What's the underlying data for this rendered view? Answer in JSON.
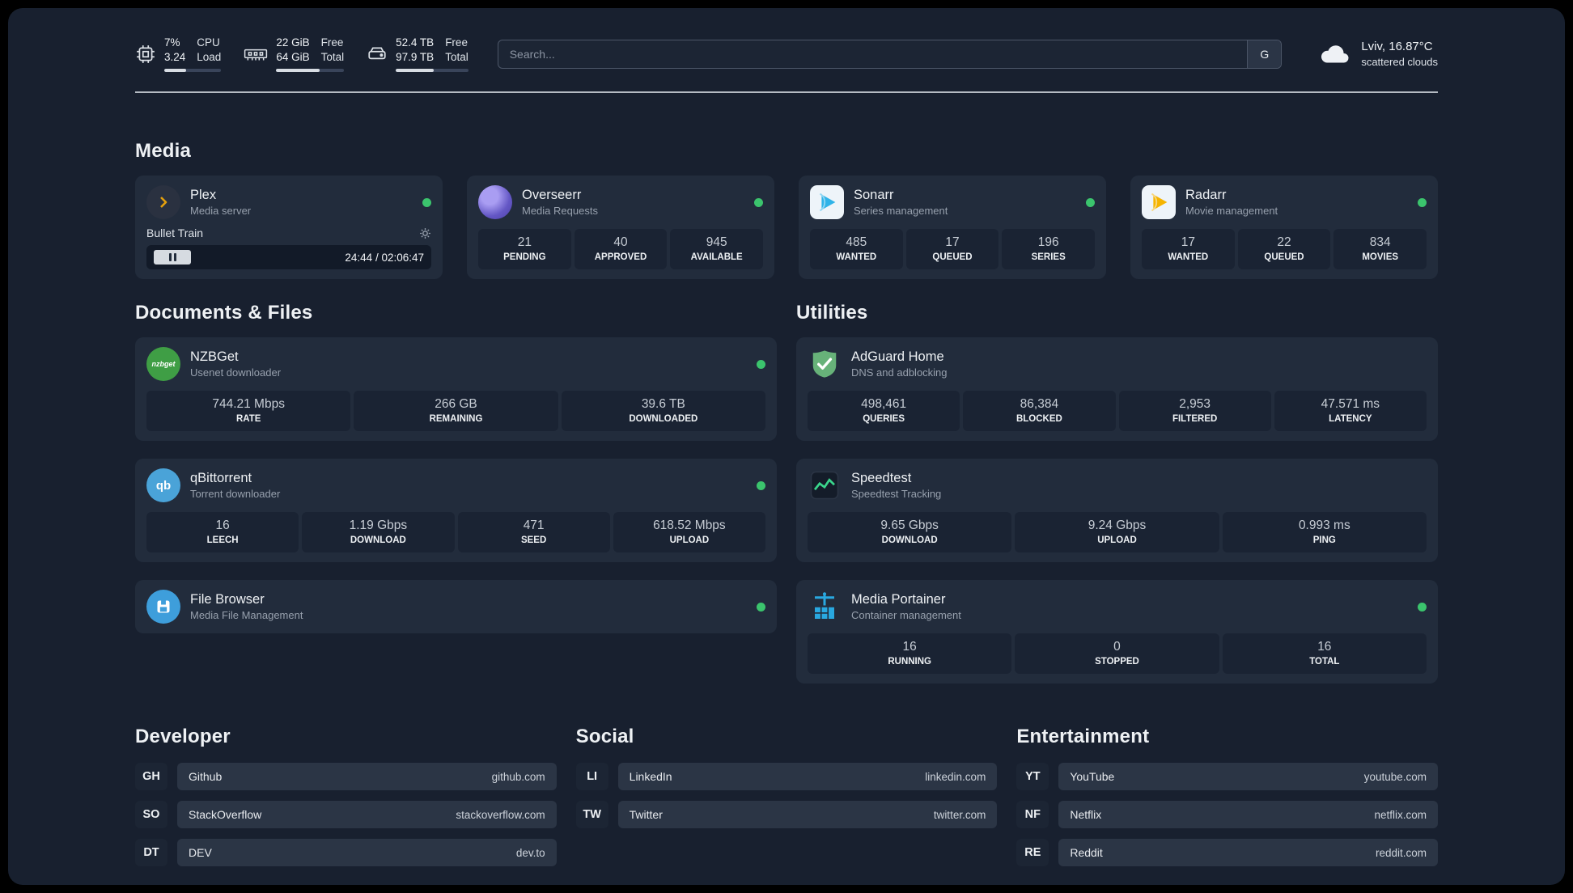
{
  "theme": {
    "background": "#18202f",
    "card": "#222c3c",
    "stat_box": "#1a2333",
    "status_green": "#3bc46d",
    "plex_accent": "#e5a00d"
  },
  "topbar": {
    "cpu": {
      "icon": "cpu-chip-icon",
      "value_top": "7%",
      "value_bottom": "3.24",
      "label_top": "CPU",
      "label_bottom": "Load"
    },
    "memory": {
      "icon": "memory-icon",
      "value_top": "22 GiB",
      "value_bottom": "64 GiB",
      "label_top": "Free",
      "label_bottom": "Total"
    },
    "storage": {
      "icon": "storage-icon",
      "value_top": "52.4 TB",
      "value_bottom": "97.9 TB",
      "label_top": "Free",
      "label_bottom": "Total"
    },
    "search": {
      "placeholder": "Search...",
      "engine_button": "G"
    },
    "weather": {
      "icon": "cloud-icon",
      "location_temp": "Lviv, 16.87°C",
      "condition": "scattered clouds"
    }
  },
  "media": {
    "title": "Media",
    "cards": [
      {
        "icon": "plex-icon",
        "name": "Plex",
        "subtitle": "Media server",
        "now_playing": {
          "title": "Bullet Train",
          "time": "24:44 / 02:06:47"
        }
      },
      {
        "icon": "overseerr-icon",
        "name": "Overseerr",
        "subtitle": "Media Requests",
        "stats": [
          {
            "value": "21",
            "label": "PENDING"
          },
          {
            "value": "40",
            "label": "APPROVED"
          },
          {
            "value": "945",
            "label": "AVAILABLE"
          }
        ]
      },
      {
        "icon": "sonarr-icon",
        "name": "Sonarr",
        "subtitle": "Series management",
        "stats": [
          {
            "value": "485",
            "label": "WANTED"
          },
          {
            "value": "17",
            "label": "QUEUED"
          },
          {
            "value": "196",
            "label": "SERIES"
          }
        ]
      },
      {
        "icon": "radarr-icon",
        "name": "Radarr",
        "subtitle": "Movie management",
        "stats": [
          {
            "value": "17",
            "label": "WANTED"
          },
          {
            "value": "22",
            "label": "QUEUED"
          },
          {
            "value": "834",
            "label": "MOVIES"
          }
        ]
      }
    ]
  },
  "documents": {
    "title": "Documents & Files",
    "cards": [
      {
        "icon": "nzbget-icon",
        "icon_text": "nzbget",
        "name": "NZBGet",
        "subtitle": "Usenet downloader",
        "stats": [
          {
            "value": "744.21 Mbps",
            "label": "RATE"
          },
          {
            "value": "266 GB",
            "label": "REMAINING"
          },
          {
            "value": "39.6 TB",
            "label": "DOWNLOADED"
          }
        ]
      },
      {
        "icon": "qbittorrent-icon",
        "icon_text": "qb",
        "name": "qBittorrent",
        "subtitle": "Torrent downloader",
        "stats": [
          {
            "value": "16",
            "label": "LEECH"
          },
          {
            "value": "1.19 Gbps",
            "label": "DOWNLOAD"
          },
          {
            "value": "471",
            "label": "SEED"
          },
          {
            "value": "618.52 Mbps",
            "label": "UPLOAD"
          }
        ]
      },
      {
        "icon": "filebrowser-icon",
        "name": "File Browser",
        "subtitle": "Media File Management"
      }
    ]
  },
  "utilities": {
    "title": "Utilities",
    "cards": [
      {
        "icon": "adguard-icon",
        "name": "AdGuard Home",
        "subtitle": "DNS and adblocking",
        "stats": [
          {
            "value": "498,461",
            "label": "QUERIES"
          },
          {
            "value": "86,384",
            "label": "BLOCKED"
          },
          {
            "value": "2,953",
            "label": "FILTERED"
          },
          {
            "value": "47.571 ms",
            "label": "LATENCY"
          }
        ]
      },
      {
        "icon": "speedtest-icon",
        "name": "Speedtest",
        "subtitle": "Speedtest Tracking",
        "stats": [
          {
            "value": "9.65 Gbps",
            "label": "DOWNLOAD"
          },
          {
            "value": "9.24 Gbps",
            "label": "UPLOAD"
          },
          {
            "value": "0.993 ms",
            "label": "PING"
          }
        ]
      },
      {
        "icon": "portainer-icon",
        "name": "Media Portainer",
        "subtitle": "Container management",
        "stats": [
          {
            "value": "16",
            "label": "RUNNING"
          },
          {
            "value": "0",
            "label": "STOPPED"
          },
          {
            "value": "16",
            "label": "TOTAL"
          }
        ]
      }
    ]
  },
  "bookmarks": [
    {
      "title": "Developer",
      "items": [
        {
          "abbr": "GH",
          "name": "Github",
          "url": "github.com"
        },
        {
          "abbr": "SO",
          "name": "StackOverflow",
          "url": "stackoverflow.com"
        },
        {
          "abbr": "DT",
          "name": "DEV",
          "url": "dev.to"
        }
      ]
    },
    {
      "title": "Social",
      "items": [
        {
          "abbr": "LI",
          "name": "LinkedIn",
          "url": "linkedin.com"
        },
        {
          "abbr": "TW",
          "name": "Twitter",
          "url": "twitter.com"
        }
      ]
    },
    {
      "title": "Entertainment",
      "items": [
        {
          "abbr": "YT",
          "name": "YouTube",
          "url": "youtube.com"
        },
        {
          "abbr": "NF",
          "name": "Netflix",
          "url": "netflix.com"
        },
        {
          "abbr": "RE",
          "name": "Reddit",
          "url": "reddit.com"
        }
      ]
    }
  ]
}
